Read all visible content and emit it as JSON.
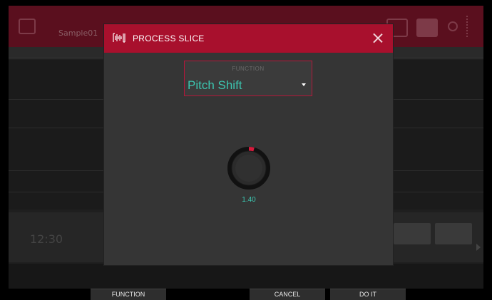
{
  "background": {
    "title": "Sample01",
    "position": "12:30"
  },
  "dialog": {
    "title": "PROCESS SLICE",
    "function_label": "FUNCTION",
    "function_value": "Pitch Shift",
    "knob_value": "1.40"
  },
  "softkeys": {
    "f1": "FUNCTION",
    "f4": "CANCEL",
    "f5": "DO IT"
  },
  "colors": {
    "accent": "#a8102d",
    "value_text": "#3cc6b0",
    "dialog_bg": "#353535"
  },
  "icons": {
    "header": "waveform-icon",
    "close": "close-icon",
    "dropdown": "caret-down-icon"
  }
}
